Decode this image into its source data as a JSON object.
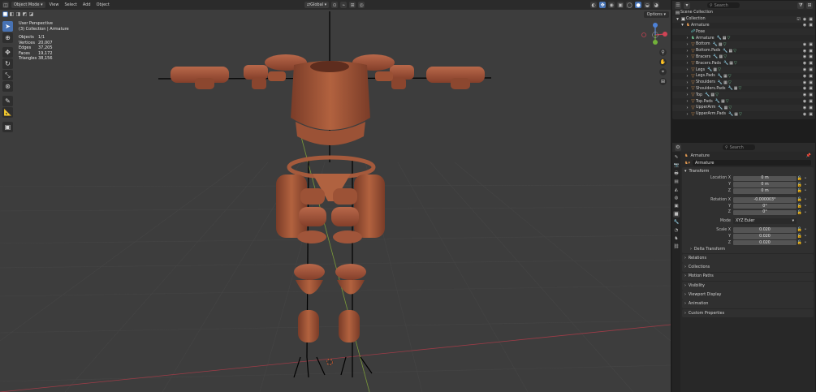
{
  "header": {
    "mode": "Object Mode",
    "menus": [
      "View",
      "Select",
      "Add",
      "Object"
    ],
    "transform_orientation": "Global",
    "options": "Options"
  },
  "viewport": {
    "perspective": "User Perspective",
    "collection_path": "(3) Collection | Armature",
    "stats": [
      {
        "key": "Objects",
        "value": "1/1"
      },
      {
        "key": "Vertices",
        "value": "20,007"
      },
      {
        "key": "Edges",
        "value": "37,205"
      },
      {
        "key": "Faces",
        "value": "19,172"
      },
      {
        "key": "Triangles",
        "value": "38,156"
      }
    ]
  },
  "outliner": {
    "search_placeholder": "Search",
    "scene_collection": "Scene Collection",
    "collection": "Collection",
    "armature_root": "Armature",
    "items": [
      {
        "name": "Pose",
        "icon": "pose-icon"
      },
      {
        "name": "Armature",
        "icon": "armature-data-icon"
      },
      {
        "name": "Bottom",
        "icon": "mesh-icon"
      },
      {
        "name": "Bottom.Pads",
        "icon": "mesh-icon"
      },
      {
        "name": "Bracers",
        "icon": "mesh-icon"
      },
      {
        "name": "Bracers.Pads",
        "icon": "mesh-icon"
      },
      {
        "name": "Legs",
        "icon": "mesh-icon"
      },
      {
        "name": "Legs.Pads",
        "icon": "mesh-icon"
      },
      {
        "name": "Shoulders",
        "icon": "mesh-icon"
      },
      {
        "name": "Shoulders.Pads",
        "icon": "mesh-icon"
      },
      {
        "name": "Top",
        "icon": "mesh-icon"
      },
      {
        "name": "Top.Pads",
        "icon": "mesh-icon"
      },
      {
        "name": "UpperArm",
        "icon": "mesh-icon"
      },
      {
        "name": "UpperArm.Pads",
        "icon": "mesh-icon"
      }
    ]
  },
  "properties": {
    "search_placeholder": "Search",
    "object_name": "Armature",
    "data_name": "Armature",
    "transform": {
      "title": "Transform",
      "location_label": "Location X",
      "location": [
        "0 m",
        "0 m",
        "0 m"
      ],
      "rotation_label": "Rotation X",
      "rotation": [
        "-0.000003°",
        "0°",
        "0°"
      ],
      "mode_label": "Mode",
      "mode": "XYZ Euler",
      "scale_label": "Scale X",
      "scale": [
        "0.020",
        "0.020",
        "0.020"
      ],
      "axis_y": "Y",
      "axis_z": "Z",
      "delta": "Delta Transform"
    },
    "panels": [
      "Relations",
      "Collections",
      "Motion Paths",
      "Visibility",
      "Viewport Display",
      "Animation",
      "Custom Properties"
    ]
  },
  "colors": {
    "armor": "#a3573c",
    "armor_shadow": "#6e3523",
    "armor_light": "#c0714f",
    "accent": "#4772b3",
    "viewport_bg": "#3d3d3d"
  }
}
